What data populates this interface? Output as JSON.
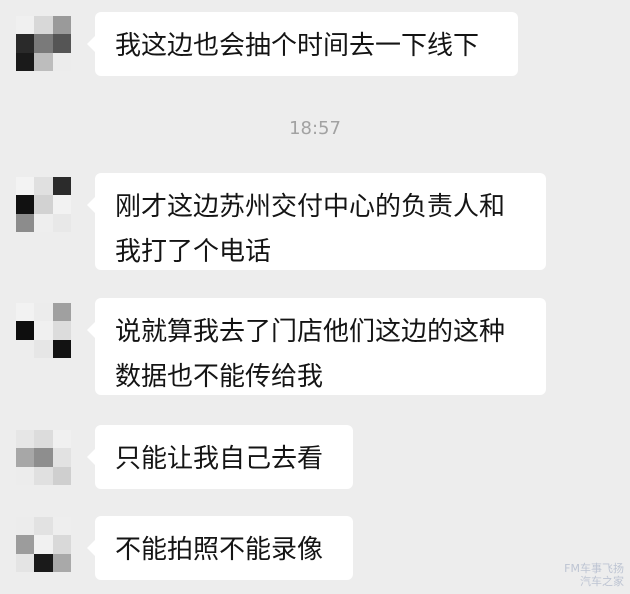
{
  "chat": {
    "timestamp": "18:57",
    "messages": [
      {
        "text": "我这边也会抽个时间去一下线下"
      },
      {
        "text": "刚才这边苏州交付中心的负责人和\n我打了个电话"
      },
      {
        "text": "说就算我去了门店他们这边的这种\n数据也不能传给我"
      },
      {
        "text": "只能让我自己去看"
      },
      {
        "text": "不能拍照不能录像"
      }
    ]
  },
  "watermark": {
    "line1": "FM车事飞扬",
    "line2": "汽车之家"
  },
  "colors": {
    "background": "#ededed",
    "bubble": "#ffffff",
    "text": "#141414",
    "timestamp": "#a2a2a2"
  }
}
